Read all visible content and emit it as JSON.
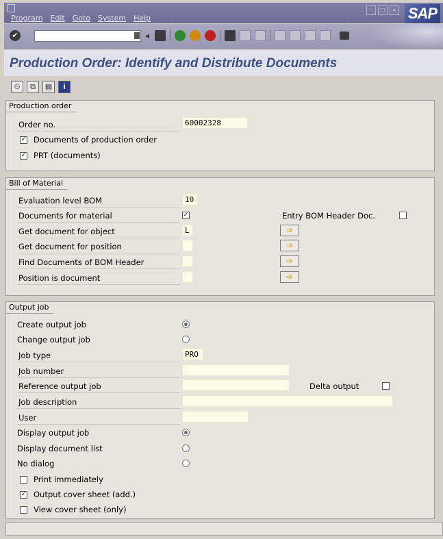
{
  "menu": {
    "items": [
      "Program",
      "Edit",
      "Goto",
      "System",
      "Help"
    ],
    "logo_text": "SAP"
  },
  "std_toolbar": {
    "command_field_value": "",
    "icons": [
      "enter-icon",
      "save-icon",
      "back-icon",
      "exit-icon",
      "cancel-icon",
      "print-icon",
      "find-icon",
      "find-next-icon",
      "first-page-icon",
      "prev-page-icon",
      "next-page-icon",
      "last-page-icon",
      "create-session-icon"
    ]
  },
  "title": "Production Order: Identify and Distribute Documents",
  "app_toolbar": {
    "icons": [
      "execute-icon",
      "copy-icon",
      "save-variant-icon",
      "info-icon"
    ]
  },
  "production_order": {
    "group_title": "Production order",
    "order_no_label": "Order no.",
    "order_no_value": "60002328",
    "docs_prod_order_label": "Documents of production order",
    "docs_prod_order_checked": true,
    "prt_label": "PRT (documents)",
    "prt_checked": true
  },
  "bom": {
    "group_title": "Bill of Material",
    "eval_level_label": "Evaluation level BOM",
    "eval_level_value": "10",
    "docs_material_label": "Documents for material",
    "docs_material_checked": true,
    "entry_header_label": "Entry BOM Header Doc.",
    "entry_header_checked": false,
    "get_doc_object_label": "Get document for object",
    "get_doc_object_value": "L",
    "get_doc_position_label": "Get document for position",
    "get_doc_position_value": "",
    "find_docs_header_label": "Find Documents of BOM Header",
    "find_docs_header_value": "",
    "position_is_doc_label": "Position is document",
    "position_is_doc_value": ""
  },
  "output_job": {
    "group_title": "Output job",
    "create_label": "Create output job",
    "create_selected": true,
    "change_label": "Change output job",
    "change_selected": false,
    "job_type_label": "Job type",
    "job_type_value": "PRO",
    "job_number_label": "Job number",
    "job_number_value": "",
    "ref_job_label": "Reference output job",
    "ref_job_value": "",
    "delta_output_label": "Delta output",
    "delta_output_checked": false,
    "job_desc_label": "Job description",
    "job_desc_value": "",
    "user_label": "User",
    "user_value": "",
    "display_job_label": "Display output job",
    "display_job_selected": true,
    "display_doclist_label": "Display document list",
    "display_doclist_selected": false,
    "no_dialog_label": "No dialog",
    "no_dialog_selected": false,
    "print_immediately_label": "Print immediately",
    "print_immediately_checked": false,
    "cover_sheet_label": "Output cover sheet (add.)",
    "cover_sheet_checked": true,
    "view_cover_label": "View cover sheet (only)",
    "view_cover_checked": false
  },
  "status": {
    "message": ""
  }
}
